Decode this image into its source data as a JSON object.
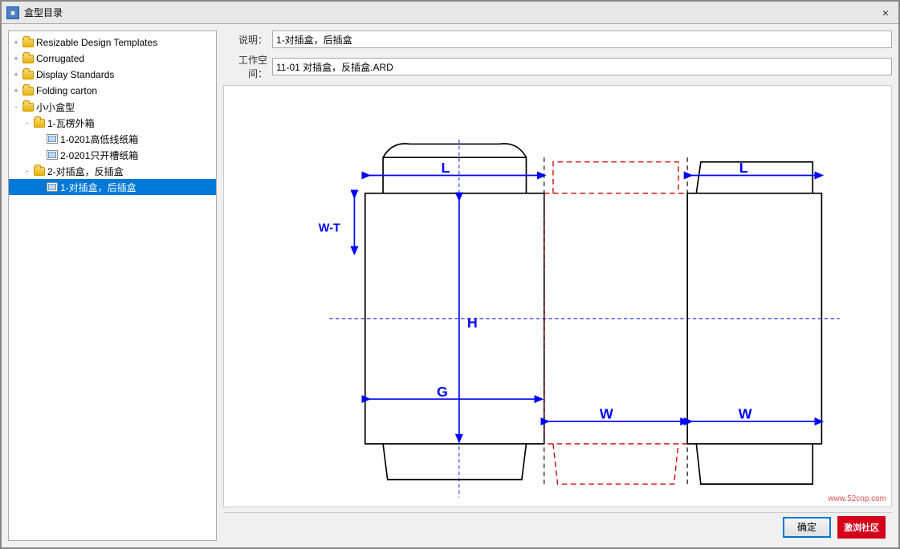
{
  "dialog": {
    "title": "盒型目录",
    "close_label": "×"
  },
  "form": {
    "description_label": "说明：",
    "description_value": "1-对插盒，后插盒",
    "workspace_label": "工作空间：",
    "workspace_value": "11-01 对插盒，反插盒.ARD"
  },
  "tree": {
    "items": [
      {
        "id": "resizable",
        "label": "Resizable Design Templates",
        "level": 0,
        "type": "folder",
        "expanded": false,
        "toggle": "+"
      },
      {
        "id": "corrugated",
        "label": "Corrugated",
        "level": 0,
        "type": "folder",
        "expanded": false,
        "toggle": "+"
      },
      {
        "id": "display-standards",
        "label": "Display Standards",
        "level": 0,
        "type": "folder",
        "expanded": false,
        "toggle": "+"
      },
      {
        "id": "folding-carton",
        "label": "Folding carton",
        "level": 0,
        "type": "folder",
        "expanded": false,
        "toggle": "+"
      },
      {
        "id": "small-boxes",
        "label": "小小盒型",
        "level": 0,
        "type": "folder",
        "expanded": true,
        "toggle": "-"
      },
      {
        "id": "corrugated-outer",
        "label": "1-瓦楞外箱",
        "level": 1,
        "type": "folder",
        "expanded": true,
        "toggle": "-"
      },
      {
        "id": "item-1-0201",
        "label": "1-0201高低线纸箱",
        "level": 2,
        "type": "leaf"
      },
      {
        "id": "item-2-0201",
        "label": "2-0201只开槽纸箱",
        "level": 2,
        "type": "leaf"
      },
      {
        "id": "insert-box",
        "label": "2-对插盒，反插盒",
        "level": 1,
        "type": "folder",
        "expanded": true,
        "toggle": "-"
      },
      {
        "id": "item-1-insert",
        "label": "1-对插盒，后插盒",
        "level": 2,
        "type": "leaf",
        "selected": true
      }
    ]
  },
  "buttons": {
    "confirm": "确定",
    "cancel": "激浏社区"
  },
  "diagram": {
    "label_L": "L",
    "label_W": "W",
    "label_H": "H",
    "label_G": "G",
    "label_WT": "W-T"
  }
}
